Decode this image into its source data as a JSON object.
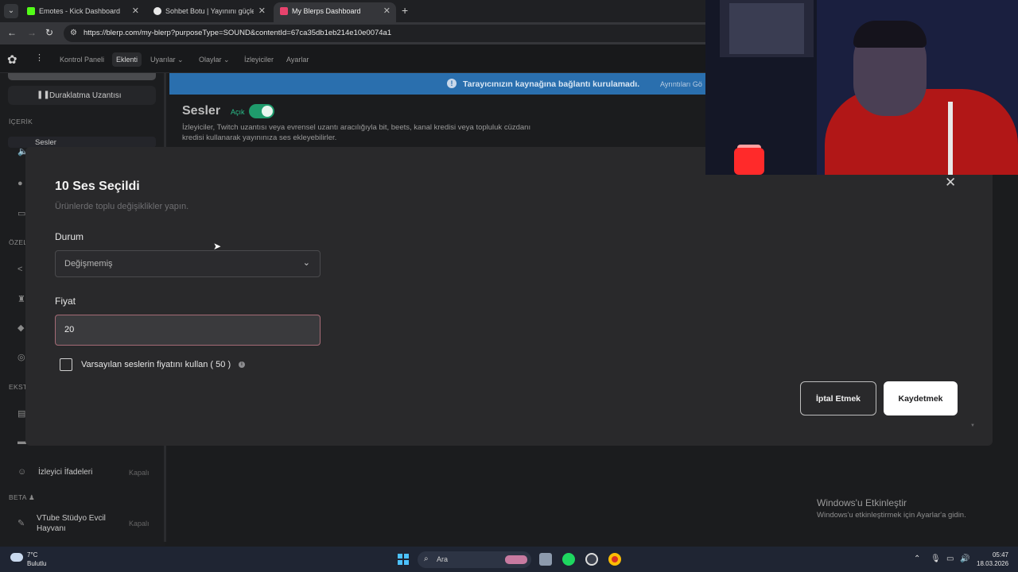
{
  "browser": {
    "tabs": [
      {
        "title": "Emotes - Kick Dashboard",
        "favicon_color": "#53fc18"
      },
      {
        "title": "Sohbet Botu | Yayınını güçlendir",
        "favicon_color": "#e8e8e8"
      },
      {
        "title": "My Blerps Dashboard",
        "favicon_color": "#e8436d"
      }
    ],
    "url": "https://blerp.com/my-blerp?purposeType=SOUND&contentId=67ca35db1eb214e10e0074a1"
  },
  "topnav": {
    "items": [
      "Kontrol Paneli",
      "Eklenti",
      "Uyarılar",
      "Olaylar",
      "İzleyiciler",
      "Ayarlar"
    ],
    "selected": "Eklenti"
  },
  "sidebar": {
    "pause_label": "Duraklatma Uzantısı",
    "section_icerik": "İÇERİK",
    "item_sesler": "Sesler",
    "section_ozel": "ÖZEL",
    "section_ekstra": "EKSTR",
    "item_izleyici": "İzleyici İfadeleri",
    "item_izleyici_status": "Kapalı",
    "section_beta": "BETA",
    "item_vtube_line1": "VTube Stüdyo Evcil",
    "item_vtube_line2": "Hayvanı",
    "item_vtube_status": "Kapalı"
  },
  "banner": {
    "text": "Tarayıcınızın kaynağına bağlantı kurulamadı.",
    "link": "Ayrıntıları Gö"
  },
  "sounds_panel": {
    "title": "Sesler",
    "status": "Açık",
    "description": "İzleyiciler, Twitch uzantısı veya evrensel uzantı aracılığıyla bit, beets, kanal kredisi veya topluluk cüzdanı kredisi kullanarak yayınınıza ses ekleyebilirler."
  },
  "modal": {
    "title": "10 Ses Seçildi",
    "subtitle": "Ürünlerde toplu değişiklikler yapın.",
    "status_label": "Durum",
    "status_value": "Değişmemiş",
    "price_label": "Fiyat",
    "price_value": "20",
    "checkbox_label": "Varsayılan seslerin fiyatını kullan ( 50 )",
    "checkbox_checked": false,
    "cancel_label": "İptal Etmek",
    "save_label": "Kaydetmek"
  },
  "activation": {
    "title": "Windows'u Etkinleştir",
    "subtitle": "Windows'u etkinleştirmek için Ayarlar'a gidin."
  },
  "taskbar": {
    "temperature": "7°C",
    "weather": "Bulutlu",
    "search_placeholder": "Ara",
    "time": "05:47",
    "date": "18.03.2026"
  }
}
